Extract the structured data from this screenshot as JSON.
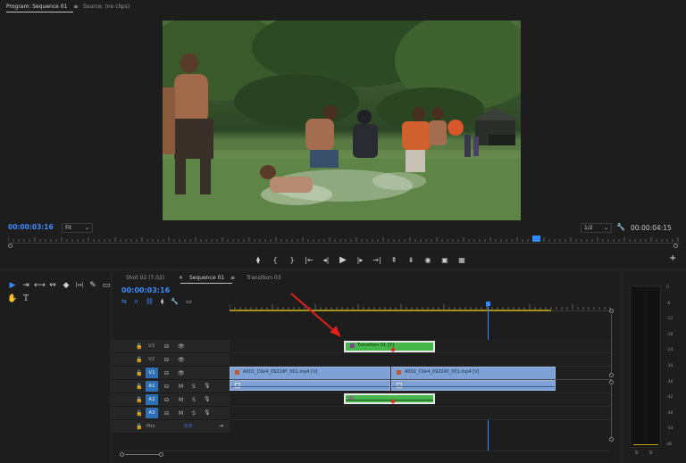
{
  "monitor": {
    "tab_program": "Program: Sequence 01",
    "tab_program_menu": "≡",
    "tab_source": "Source: (no clips)",
    "current_time": "00:00:03:16",
    "zoom": "Fit",
    "resolution": "1/2",
    "duration": "00:00:04:15"
  },
  "transport": {
    "marker": "⧫",
    "in": "{",
    "out": "}",
    "goto_in": "|←",
    "step_back": "◂|",
    "play": "▶",
    "step_fwd": "|▸",
    "goto_out": "→|",
    "lift": "⇞",
    "extract": "⇟",
    "export_frame": "◉",
    "compare": "▣",
    "vr": "▦",
    "add": "+"
  },
  "tools": {
    "selection": "▶",
    "track_select": "⇥",
    "ripple": "⟷",
    "rate": "⇔",
    "razor": "◆",
    "slip": "|↔|",
    "pen": "✎",
    "rect": "▭",
    "hand": "✋",
    "type": "T"
  },
  "timeline": {
    "tab_shot": "Shot 02 (7.02)",
    "tab_close": "×",
    "tab_sequence": "Sequence 01",
    "tab_menu": "≡",
    "tab_transition": "Transition 03",
    "timecode": "00:00:03:16",
    "tracks": [
      {
        "name": "V3",
        "lock": "🔓",
        "sync": "⊟",
        "eye": "👁"
      },
      {
        "name": "V2",
        "lock": "🔓",
        "sync": "⊟",
        "eye": "👁"
      },
      {
        "name": "V1",
        "lock": "🔓",
        "sync": "⊟",
        "eye": "👁"
      },
      {
        "name": "A1",
        "lock": "🔓",
        "sync": "⊟",
        "m": "M",
        "s": "S",
        "mic": "🎙"
      },
      {
        "name": "A2",
        "lock": "🔓",
        "sync": "⊟",
        "m": "M",
        "s": "S",
        "mic": "🎙"
      },
      {
        "name": "A3",
        "lock": "🔓",
        "sync": "⊟",
        "m": "M",
        "s": "S",
        "mic": "🎙"
      }
    ],
    "mix_label": "Mix",
    "mix_value": "0.0",
    "clip_transition": "Transition 01 [V]",
    "clip_a": "A001_C0e4_0922AY_001.mp4 [V]",
    "clip_b": "A001_C0e4_0922AY_001.mp4 [V]",
    "playhead_fraction": 0.69
  },
  "meter": {
    "db_labels": [
      "0",
      "-6",
      "-12",
      "-18",
      "-24",
      "-30",
      "-36",
      "-42",
      "-48",
      "-54",
      "dB"
    ],
    "solo_labels": [
      "S",
      "S"
    ]
  }
}
